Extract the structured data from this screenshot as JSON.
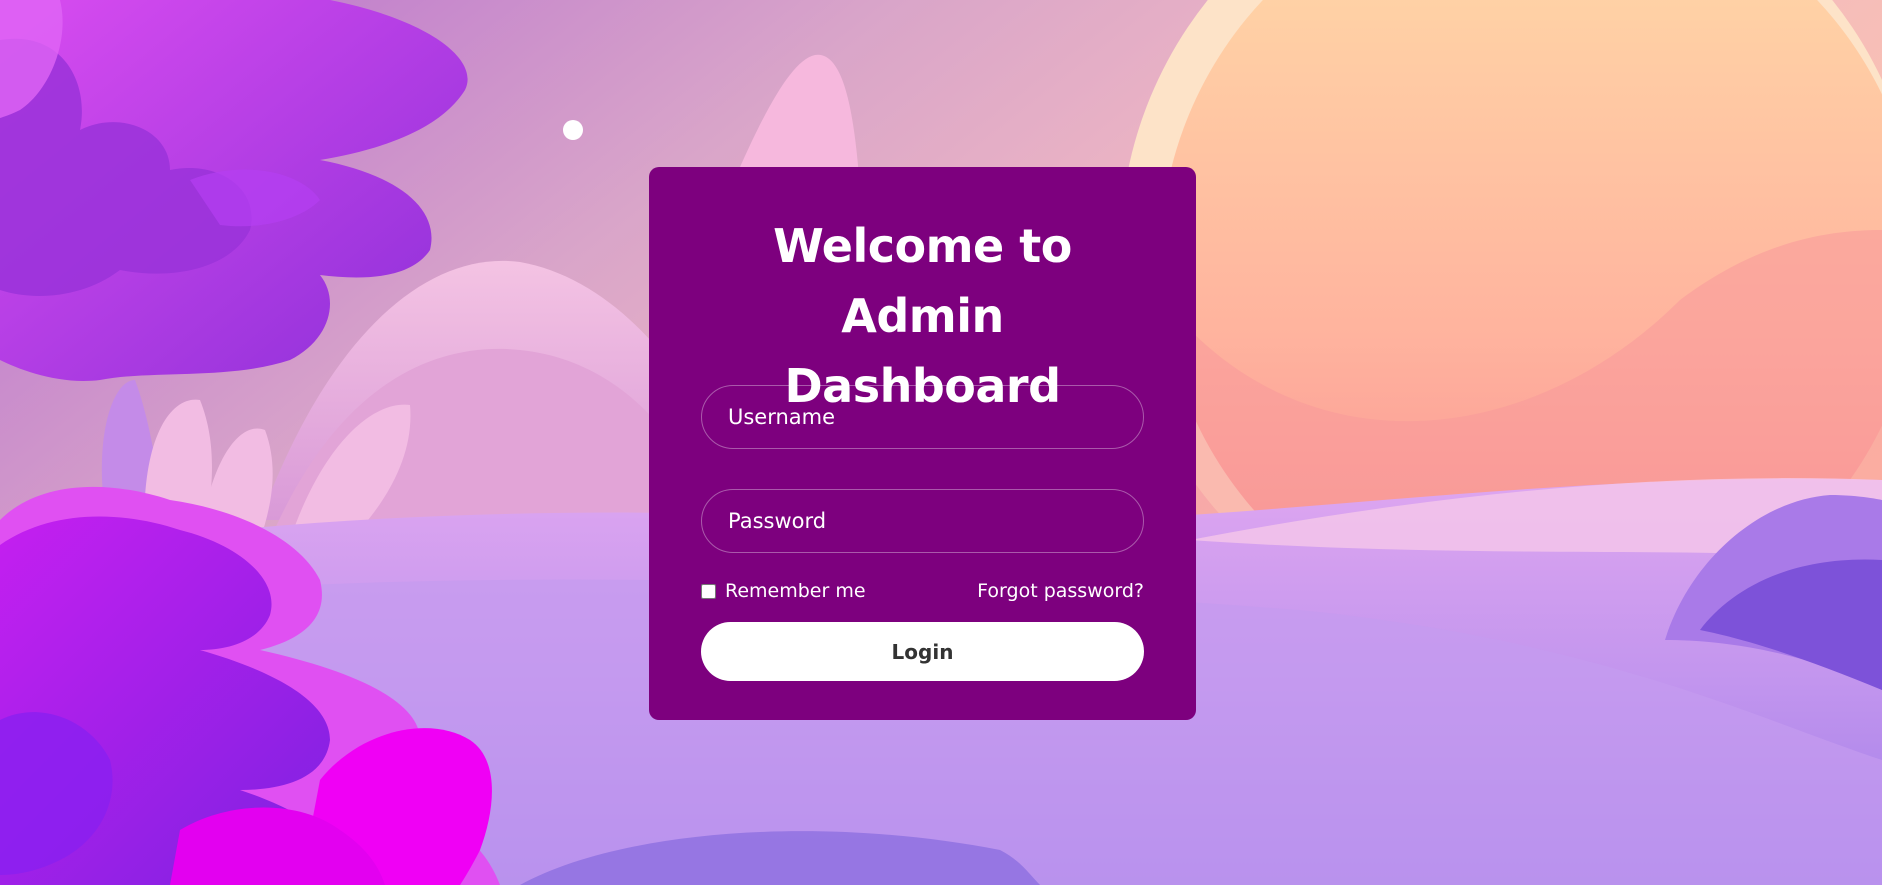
{
  "colors": {
    "card_bg": "#7d007e",
    "text": "#ffffff",
    "button_bg": "#ffffff",
    "button_text": "#333333"
  },
  "login": {
    "title_line1": "Welcome to",
    "title_line2": "Admin Dashboard",
    "username_placeholder": "Username",
    "password_placeholder": "Password",
    "remember_label": "Remember me",
    "remember_checked": false,
    "forgot_label": "Forgot password?",
    "button_label": "Login"
  },
  "background": {
    "description_icon": "landscape-illustration"
  }
}
